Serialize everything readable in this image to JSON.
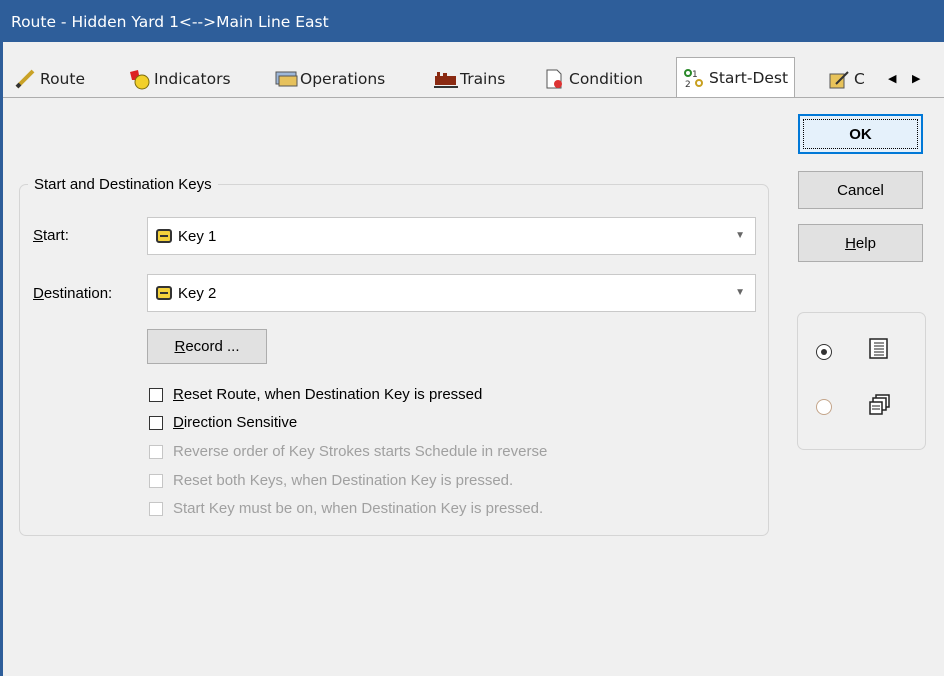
{
  "window": {
    "title": "Route - Hidden Yard 1<-->Main Line East"
  },
  "tabs": [
    {
      "label": "Route",
      "icon": "pencil-icon"
    },
    {
      "label": "Indicators",
      "icon": "indicators-icon"
    },
    {
      "label": "Operations",
      "icon": "operations-icon"
    },
    {
      "label": "Trains",
      "icon": "trains-icon"
    },
    {
      "label": "Condition",
      "icon": "condition-icon"
    },
    {
      "label": "Start-Dest",
      "icon": "start-dest-icon",
      "active": true
    },
    {
      "label": "C",
      "icon": "clipboard-icon"
    }
  ],
  "buttons": {
    "ok": "OK",
    "cancel": "Cancel",
    "help_h": "H",
    "help_rest": "elp",
    "record_r": "R",
    "record_rest": "ecord ..."
  },
  "group": {
    "title": "Start and Destination Keys",
    "start_label_u": "S",
    "start_label_rest": "tart:",
    "start_value": "Key 1",
    "dest_label_u": "D",
    "dest_label_rest": "estination:",
    "dest_value": "Key 2"
  },
  "checkboxes": [
    {
      "u": "R",
      "rest": "eset Route, when Destination Key is pressed",
      "checked": false,
      "enabled": true
    },
    {
      "u": "D",
      "rest": "irection Sensitive",
      "checked": false,
      "enabled": true
    },
    {
      "u": "",
      "rest": "Reverse order of Key Strokes starts Schedule in reverse",
      "checked": false,
      "enabled": false
    },
    {
      "u": "",
      "rest": "Reset both Keys, when Destination Key is pressed.",
      "checked": false,
      "enabled": false
    },
    {
      "u": "",
      "rest": "Start Key must be on, when Destination Key is pressed.",
      "checked": false,
      "enabled": false
    }
  ],
  "view_options": [
    {
      "icon": "list-view-icon",
      "selected": true
    },
    {
      "icon": "window-view-icon",
      "selected": false
    }
  ],
  "colors": {
    "titlebar": "#2e5e9a",
    "key_icon": "#f4d23c",
    "default_button_border": "#0078d7"
  }
}
